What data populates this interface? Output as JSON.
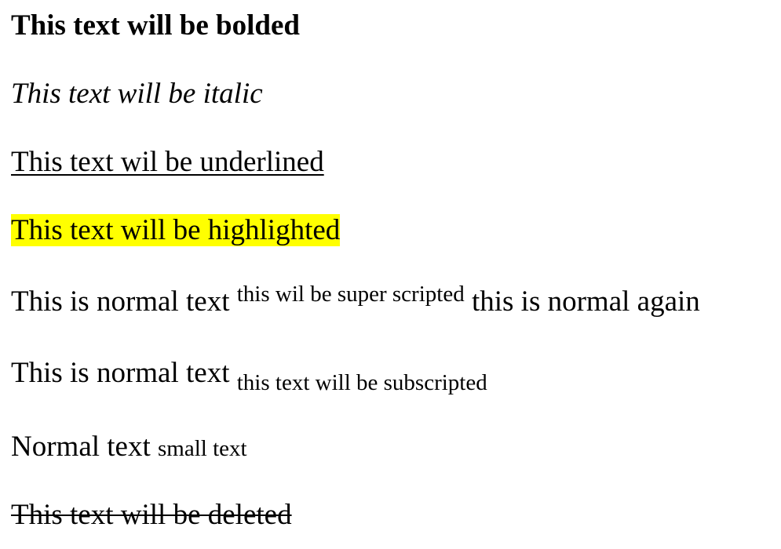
{
  "lines": {
    "bold": "This text will be bolded",
    "italic": "This text will be italic",
    "underlined": "This text wil be underlined",
    "highlighted": "This text will be highlighted",
    "superscript_line": {
      "before": "This is normal text",
      "sup": "this wil be super scripted",
      "after": "this is normal again"
    },
    "subscript_line": {
      "before": "This is normal text",
      "sub": "this text will be subscripted"
    },
    "small_line": {
      "normal": "Normal text",
      "small": "small text"
    },
    "deleted": "This text will be deleted"
  },
  "colors": {
    "highlight": "#ffff00",
    "text": "#000000",
    "background": "#ffffff"
  }
}
